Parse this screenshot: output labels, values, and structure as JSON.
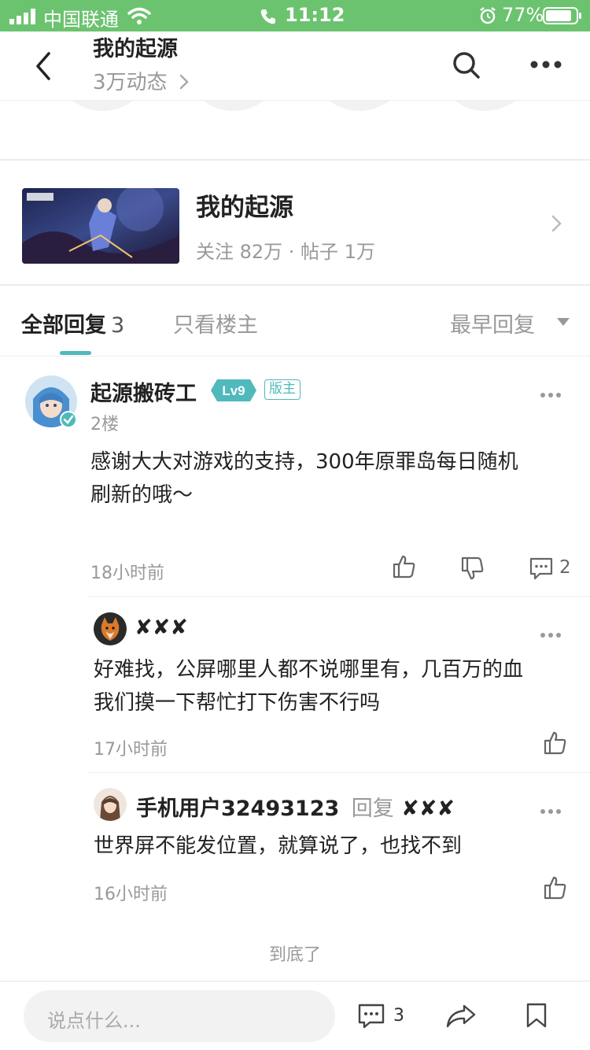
{
  "status_bar": {
    "carrier": "中国联通",
    "time": "11:12",
    "battery": "77%"
  },
  "nav": {
    "title": "我的起源",
    "subtitle": "3万动态",
    "accent": "#6cc36f"
  },
  "forum": {
    "name": "我的起源",
    "stats": "关注 82万 · 帖子 1万"
  },
  "tabs": {
    "all_label": "全部回复",
    "all_count": "3",
    "owner_only": "只看楼主",
    "sort": "最早回复",
    "accent": "#4fb9bb"
  },
  "comment": {
    "author": "起源搬砖工",
    "level": "Lv9",
    "role": "版主",
    "floor": "2楼",
    "text_line1": "感谢大大对游戏的支持，300年原罪岛每日随机",
    "text_line2": "刷新的哦～",
    "time": "18小时前",
    "reply_count": "2"
  },
  "replies": [
    {
      "author": "✘✘✘",
      "text_line1": "好难找，公屏哪里人都不说哪里有，几百万的血",
      "text_line2": "我们摸一下帮忙打下伤害不行吗",
      "time": "17小时前"
    },
    {
      "author": "手机用户32493123",
      "reply_label": "回复",
      "reply_to": "✘✘✘",
      "text_line1": "世界屏不能发位置，就算说了，也找不到",
      "time": "16小时前"
    }
  ],
  "end_text": "到底了",
  "bottom_bar": {
    "placeholder": "说点什么...",
    "comment_count": "3"
  }
}
